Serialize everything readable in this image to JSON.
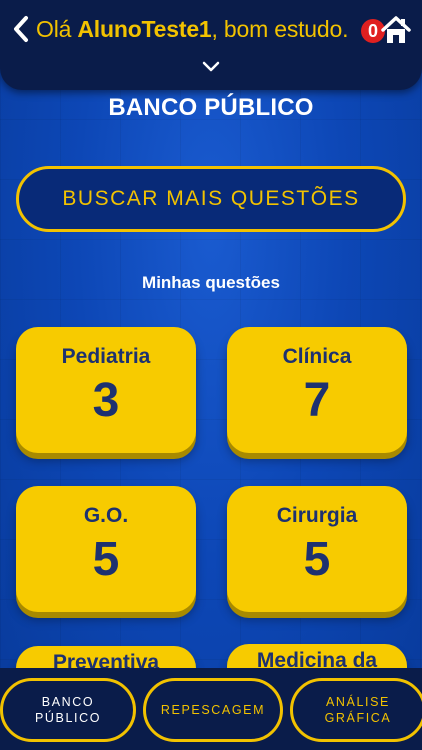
{
  "header": {
    "greeting_prefix": "Olá ",
    "username": "AlunoTeste1",
    "greeting_suffix": ", bom estudo.",
    "notification_count": "0",
    "back_icon": "chevron-left-icon",
    "home_icon": "home-icon",
    "expand_icon": "chevron-down-icon"
  },
  "page": {
    "title": "BANCO PÚBLICO",
    "search_button": "BUSCAR MAIS QUESTÕES",
    "subheading": "Minhas questões"
  },
  "categories": [
    {
      "name": "Pediatria",
      "count": "3"
    },
    {
      "name": "Clínica",
      "count": "7"
    },
    {
      "name": "G.O.",
      "count": "5"
    },
    {
      "name": "Cirurgia",
      "count": "5"
    },
    {
      "name": "Preventiva",
      "count": ""
    },
    {
      "name": "Medicina da",
      "count": ""
    }
  ],
  "bottom_nav": {
    "banco_line1": "BANCO",
    "banco_line2": "PÚBLICO",
    "repescagem": "REPESCAGEM",
    "analise_line1": "ANÁLISE",
    "analise_line2": "GRÁFICA"
  },
  "colors": {
    "accent": "#f2c200",
    "card": "#f7cb00",
    "card_text": "#1d3170",
    "header_bg": "#0a1c4a",
    "page_bg": "#0b47b8",
    "badge": "#e02020"
  }
}
